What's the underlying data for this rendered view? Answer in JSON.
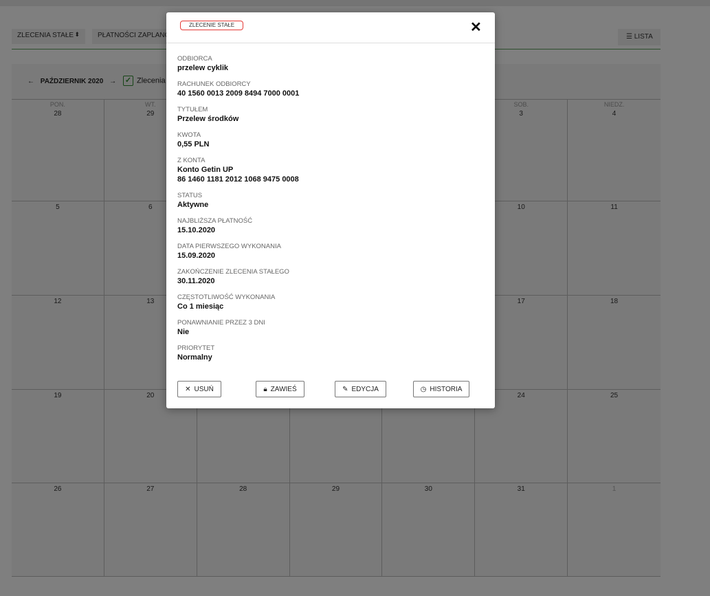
{
  "filters": {
    "select1": "ZLECENIA STAŁE",
    "select2": "PŁATNOŚCI ZAPLANOWA",
    "list_button": "LISTA",
    "list_icon": "list-icon"
  },
  "calendar": {
    "month": "PAŹDZIERNIK 2020",
    "checkbox_label": "Zlecenia",
    "weeks": [
      [
        {
          "n": "PON.",
          "d": "28"
        },
        {
          "n": "WT.",
          "d": "29"
        },
        {
          "n": "",
          "d": ""
        },
        {
          "n": "",
          "d": ""
        },
        {
          "n": "",
          "d": ""
        },
        {
          "n": "SOB.",
          "d": "3"
        },
        {
          "n": "NIEDZ.",
          "d": "4"
        }
      ],
      [
        {
          "d": "5"
        },
        {
          "d": "6"
        },
        {
          "d": ""
        },
        {
          "d": ""
        },
        {
          "d": ""
        },
        {
          "d": "10"
        },
        {
          "d": "11"
        }
      ],
      [
        {
          "d": "12"
        },
        {
          "d": "13"
        },
        {
          "d": ""
        },
        {
          "d": ""
        },
        {
          "d": ""
        },
        {
          "d": "17"
        },
        {
          "d": "18"
        }
      ],
      [
        {
          "d": "19"
        },
        {
          "d": "20"
        },
        {
          "d": ""
        },
        {
          "d": ""
        },
        {
          "d": ""
        },
        {
          "d": "24"
        },
        {
          "d": "25"
        }
      ],
      [
        {
          "d": "26"
        },
        {
          "d": "27"
        },
        {
          "d": "28"
        },
        {
          "d": "29"
        },
        {
          "d": "30"
        },
        {
          "d": "31"
        },
        {
          "d": "1",
          "muted": true
        }
      ]
    ]
  },
  "modal": {
    "badge": "ZLECENIE STAŁE",
    "close_icon": "close-icon",
    "fields": [
      {
        "label": "ODBIORCA",
        "value": "przelew cyklik"
      },
      {
        "label": "RACHUNEK ODBIORCY",
        "value": "40 1560 0013 2009 8494 7000 0001"
      },
      {
        "label": "TYTUŁEM",
        "value": "Przelew środków"
      },
      {
        "label": "KWOTA",
        "value": "0,55 PLN"
      },
      {
        "label": "Z KONTA",
        "value": "Konto Getin UP",
        "value2": "86 1460 1181 2012 1068 9475 0008"
      },
      {
        "label": "STATUS",
        "value": "Aktywne"
      },
      {
        "label": "NAJBLIŻSZA PŁATNOŚĆ",
        "value": "15.10.2020"
      },
      {
        "label": "DATA PIERWSZEGO WYKONANIA",
        "value": "15.09.2020"
      },
      {
        "label": "ZAKOŃCZENIE ZLECENIA STAŁEGO",
        "value": "30.11.2020"
      },
      {
        "label": "CZĘSTOTLIWOŚĆ WYKONANIA",
        "value": "Co 1 miesiąc"
      },
      {
        "label": "PONAWNIANIE PRZEZ 3 DNI",
        "value": "Nie"
      },
      {
        "label": "PRIORYTET",
        "value": "Normalny"
      }
    ],
    "buttons": {
      "delete": "USUŃ",
      "suspend": "ZAWIEŚ",
      "edit": "EDYCJA",
      "history": "HISTORIA"
    }
  }
}
